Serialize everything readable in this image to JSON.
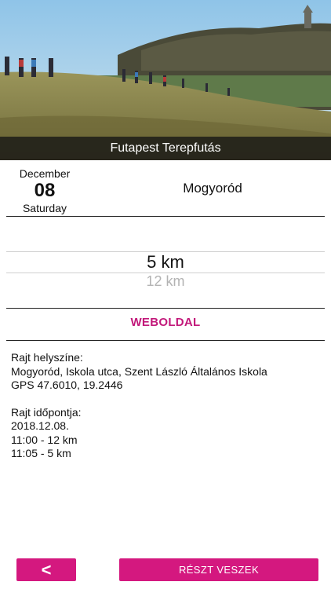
{
  "event": {
    "title": "Futapest Terepfutás",
    "date_month": "December",
    "date_day": "08",
    "date_weekday": "Saturday",
    "location": "Mogyoród"
  },
  "distance_picker": {
    "selected": "5 km",
    "next": "12 km"
  },
  "website_label": "WEBOLDAL",
  "info": {
    "start_place_label": "Rajt helyszíne:",
    "start_place": "Mogyoród, Iskola utca, Szent László Általános Iskola",
    "gps": "GPS 47.6010, 19.2446",
    "start_time_label": "Rajt időpontja:",
    "start_date": "2018.12.08.",
    "start_times": [
      "11:00 - 12 km",
      "11:05 - 5 km"
    ]
  },
  "buttons": {
    "back_label": "<",
    "join_label": "RÉSZT VESZEK"
  },
  "colors": {
    "accent": "#d4187f",
    "link": "#c2187a"
  },
  "icons": {
    "back": "chevron-left-icon"
  }
}
